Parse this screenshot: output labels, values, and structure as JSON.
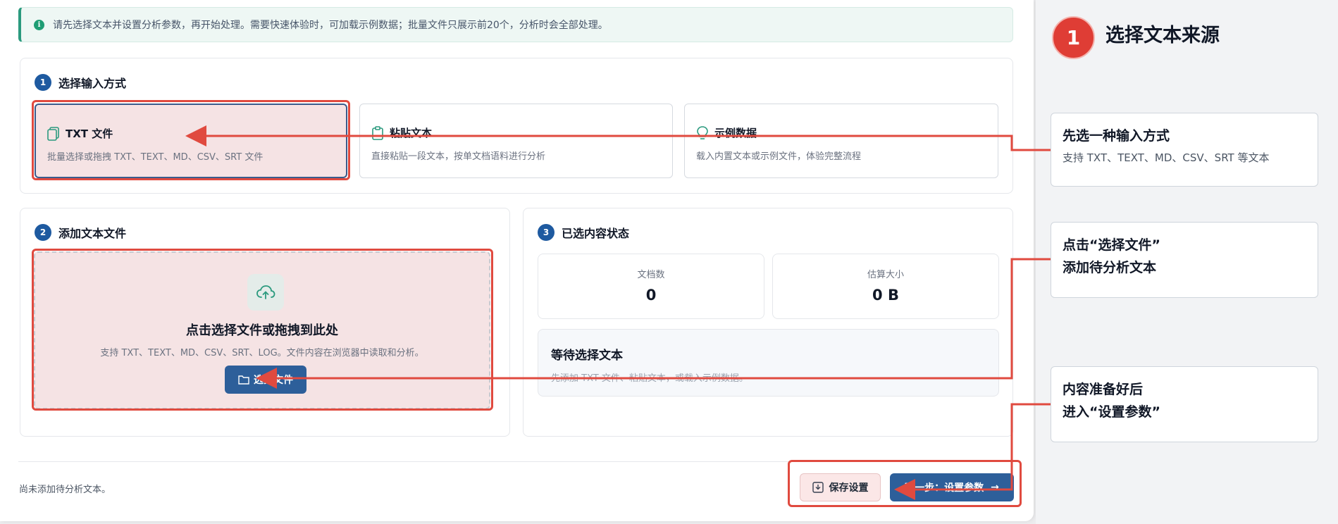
{
  "notice": {
    "text": "请先选择文本并设置分析参数，再开始处理。需要快速体验时，可加载示例数据；批量文件只展示前20个，分析时会全部处理。"
  },
  "section1": {
    "number": "1",
    "title": "选择输入方式",
    "options": [
      {
        "title": "TXT 文件",
        "desc": "批量选择或拖拽 TXT、TEXT、MD、CSV、SRT 文件",
        "icon": "file-copy-icon",
        "selected": true
      },
      {
        "title": "粘贴文本",
        "desc": "直接粘贴一段文本，按单文档语料进行分析",
        "icon": "clipboard-icon",
        "selected": false
      },
      {
        "title": "示例数据",
        "desc": "载入内置文本或示例文件，体验完整流程",
        "icon": "lightbulb-icon",
        "selected": false
      }
    ]
  },
  "section2": {
    "number": "2",
    "title": "添加文本文件",
    "dropzone_title": "点击选择文件或拖拽到此处",
    "dropzone_desc": "支持 TXT、TEXT、MD、CSV、SRT、LOG。文件内容在浏览器中读取和分析。",
    "choose_button": "选择文件",
    "icon": "cloud-upload-icon"
  },
  "section3": {
    "number": "3",
    "title": "已选内容状态",
    "stats": [
      {
        "label": "文档数",
        "value": "0"
      },
      {
        "label": "估算大小",
        "value": "0 B"
      }
    ],
    "waiting_title": "等待选择文本",
    "waiting_desc": "先添加 TXT 文件、粘贴文本，或载入示例数据。"
  },
  "footer": {
    "status": "尚未添加待分析文本。",
    "save_button": "保存设置",
    "next_button": "下一步：设置参数"
  },
  "guide": {
    "step_number": "1",
    "step_title": "选择文本来源",
    "callouts": [
      {
        "title": "先选一种输入方式",
        "desc": "支持 TXT、TEXT、MD、CSV、SRT 等文本"
      },
      {
        "title_line1": "点击“选择文件”",
        "title_line2": "添加待分析文本"
      },
      {
        "title_line1": "内容准备好后",
        "title_line2": "进入“设置参数”"
      }
    ]
  },
  "colors": {
    "accent_blue": "#2d5f9a",
    "highlight_red": "#e04a3f",
    "selected_fill": "#f5e3e4",
    "notice_green": "#2b9a7e"
  }
}
